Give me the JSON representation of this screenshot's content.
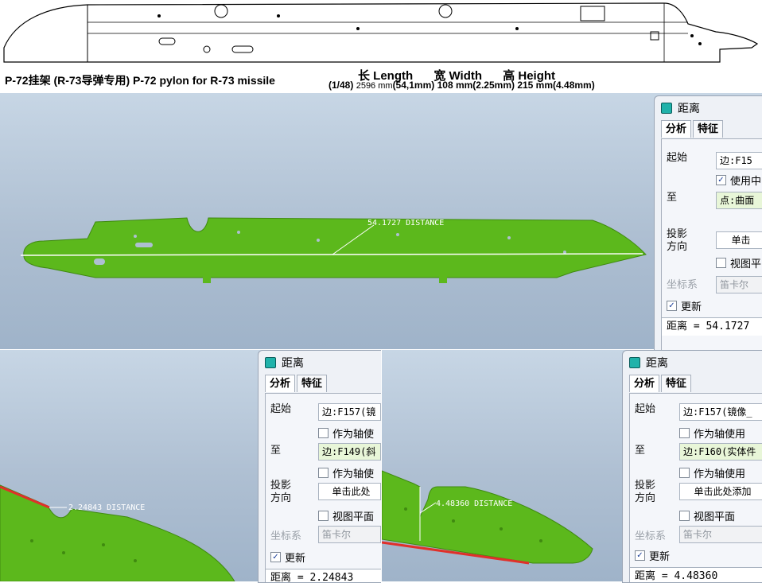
{
  "header": {
    "title": "P-72挂架 (R-73导弹专用) P-72 pylon for R-73 missile",
    "dims_labels": [
      "长 Length",
      "宽 Width",
      "高 Height"
    ],
    "scale": "(1/48)",
    "dims_values": [
      {
        "full": "2596 mm",
        "scaled": "(54,1mm)"
      },
      {
        "full": "108 mm",
        "scaled": "(2.25mm)"
      },
      {
        "full": "215 mm",
        "scaled": "(4.48mm)"
      }
    ]
  },
  "viewport_top": {
    "annotation": "54.1727 DISTANCE"
  },
  "viewport_bottom_left": {
    "annotation": "2.24843 DISTANCE"
  },
  "viewport_bottom_right": {
    "annotation": "4.48360 DISTANCE"
  },
  "dialog_top": {
    "title": "距离",
    "tabs": [
      "分析",
      "特征"
    ],
    "from_label": "起始",
    "from_value": "边:F15",
    "use_axis": "使用中",
    "to_label": "至",
    "to_value": "点:曲面",
    "projection_label": "投影\n方向",
    "projection_value": "单击",
    "view_plane": "视图平",
    "coord_label": "坐标系",
    "coord_value": "笛卡尔",
    "update": "更新",
    "result": "距离 = 54.1727"
  },
  "dialog_bl": {
    "title": "距离",
    "tabs": [
      "分析",
      "特征"
    ],
    "from_label": "起始",
    "from_value": "边:F157(镜",
    "as_axis_1": "作为轴使",
    "to_label": "至",
    "to_value": "边:F149(斜",
    "as_axis_2": "作为轴使",
    "projection_label": "投影\n方向",
    "projection_value": "单击此处",
    "view_plane": "视图平面",
    "coord_label": "坐标系",
    "coord_value": "笛卡尔",
    "update": "更新",
    "result": "距离 = 2.24843"
  },
  "dialog_br": {
    "title": "距离",
    "tabs": [
      "分析",
      "特征"
    ],
    "from_label": "起始",
    "from_value": "边:F157(镜像_",
    "as_axis_1": "作为轴使用",
    "to_label": "至",
    "to_value": "边:F160(实体件",
    "as_axis_2": "作为轴使用",
    "projection_label": "投影\n方向",
    "projection_value": "单击此处添加",
    "view_plane": "视图平面",
    "coord_label": "坐标系",
    "coord_value": "笛卡尔",
    "update": "更新",
    "result": "距离 = 4.48360"
  },
  "colors": {
    "model_green": "#5cb81c",
    "model_dark": "#3f8a10",
    "measure_line": "#ffffff",
    "edge_red": "#e0302a",
    "dialog_accent": "#20b2aa"
  }
}
